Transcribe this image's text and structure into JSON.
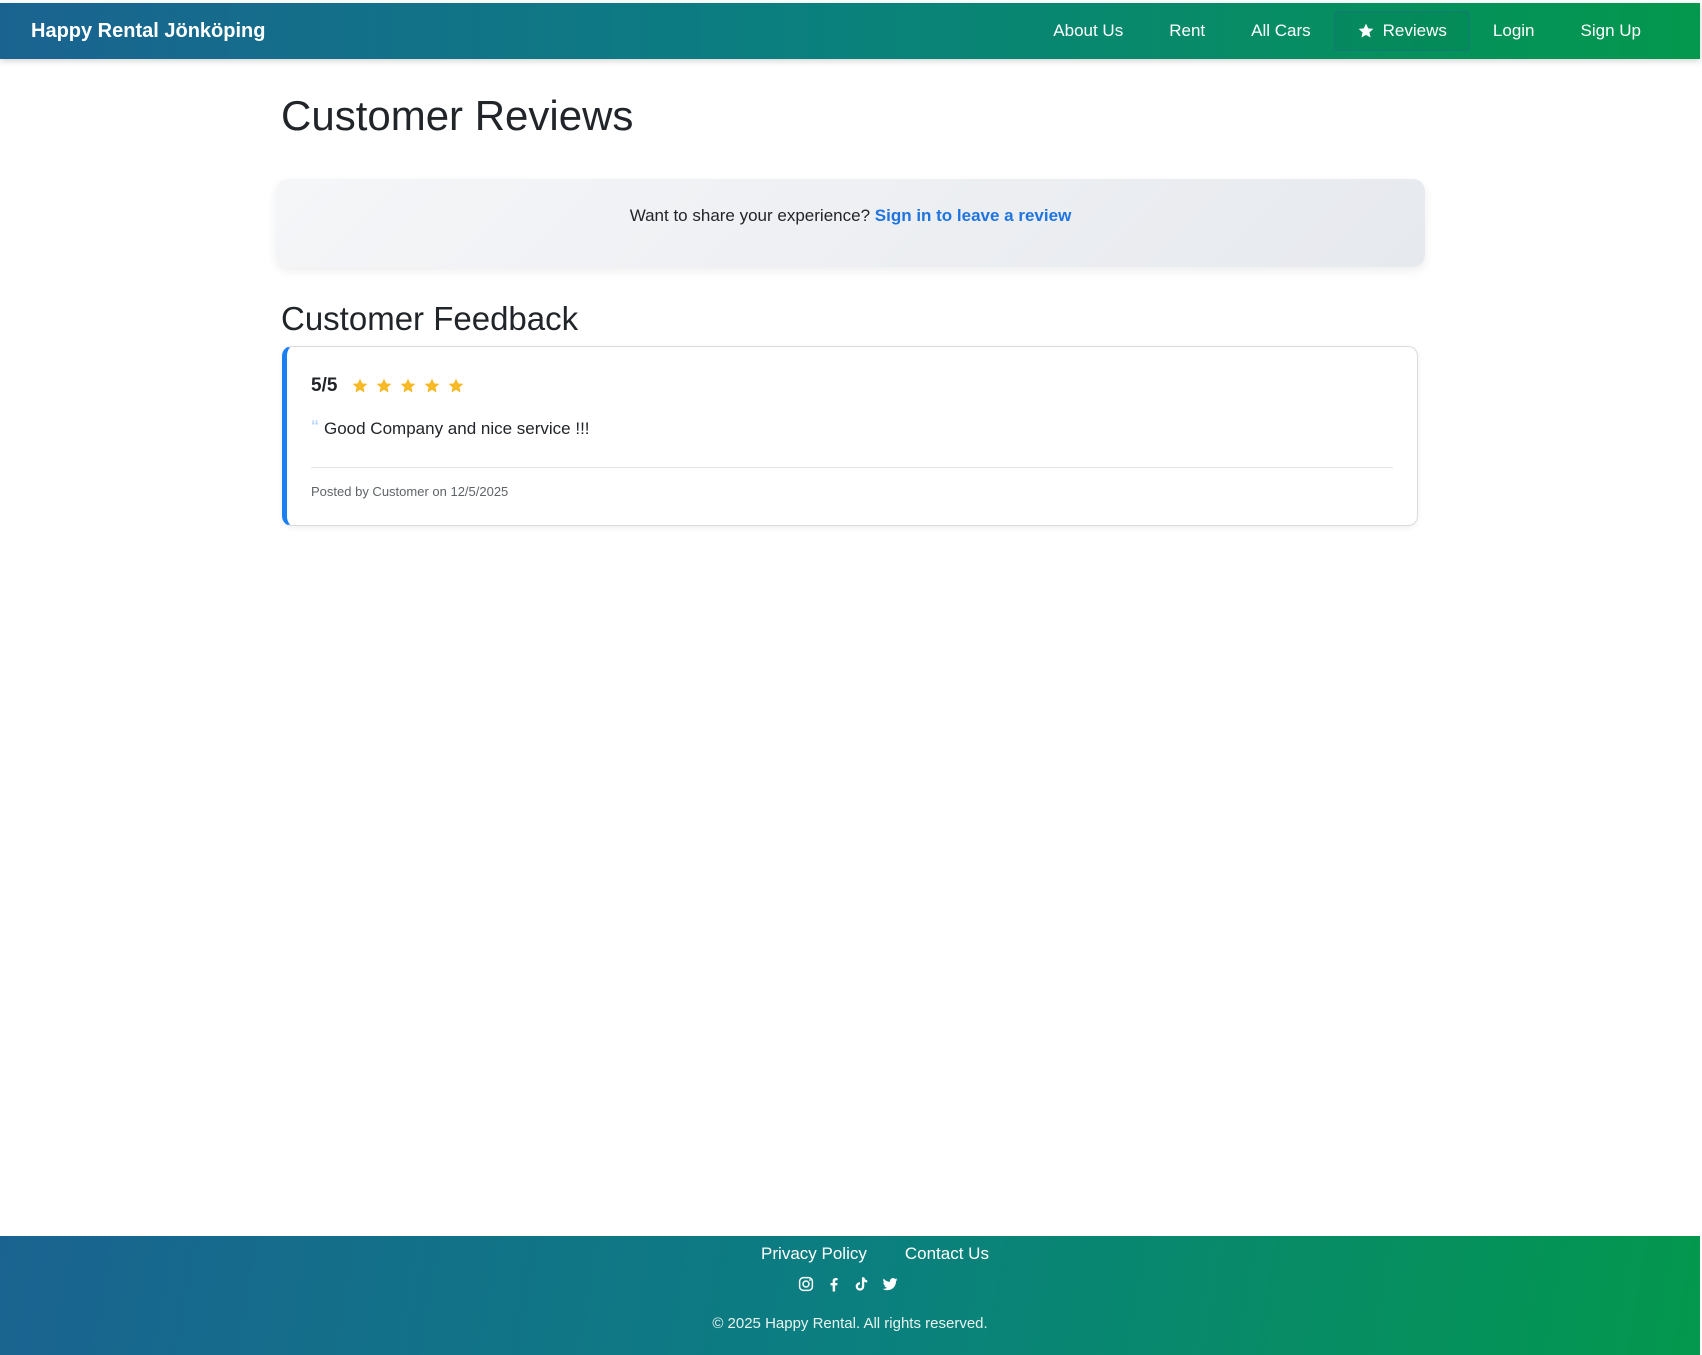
{
  "navbar": {
    "brand": "Happy Rental Jönköping",
    "items": [
      {
        "label": "About Us"
      },
      {
        "label": "Rent"
      },
      {
        "label": "All Cars"
      },
      {
        "label": "Reviews",
        "icon": "star-icon",
        "active": true
      },
      {
        "label": "Login"
      },
      {
        "label": "Sign Up"
      }
    ]
  },
  "main": {
    "page_title": "Customer Reviews",
    "cta": {
      "prompt": "Want to share your experience?",
      "link_text": "Sign in to leave a review"
    },
    "section_title": "Customer Feedback",
    "reviews": [
      {
        "rating_text": "5/5",
        "stars": 5,
        "quote_icon": "quote-icon",
        "text": "Good Company and nice service !!!",
        "posted_by": "Posted by Customer on 12/5/2025"
      }
    ]
  },
  "footer": {
    "links": [
      "Privacy Policy",
      "Contact Us"
    ],
    "social_icons": [
      "instagram-icon",
      "facebook-icon",
      "tiktok-icon",
      "twitter-icon"
    ],
    "copyright": "© 2025 Happy Rental. All rights reserved."
  },
  "colors": {
    "nav_gradient_start": "#1a6391",
    "nav_gradient_end": "#03984d",
    "link_blue": "#1f74e0",
    "card_accent": "#1a7ff2",
    "star": "#f7b928"
  }
}
